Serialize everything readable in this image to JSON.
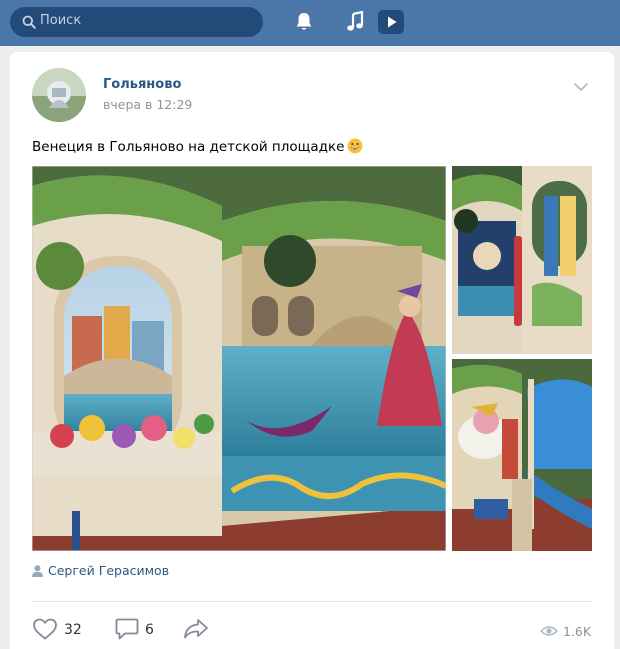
{
  "header": {
    "search_placeholder": "Поиск",
    "icons": [
      "search-icon",
      "bell-icon",
      "music-icon",
      "video-icon"
    ],
    "accent_color": "#4a76a8"
  },
  "post": {
    "author": "Гольяново",
    "date": "вчера в 12:29",
    "text": "Венеция в Гольяново на детской площадке",
    "emoji": "😀",
    "signer": "Сергей Герасимов",
    "photos": [
      "Венецианская роспись игровой площадки: мост, цветы, гондола и дама в маске",
      "Расписная панель с каналом и куполом",
      "Панель с арлекином и синей горкой"
    ]
  },
  "actions": {
    "likes": "32",
    "comments": "6",
    "views": "1.6K"
  }
}
